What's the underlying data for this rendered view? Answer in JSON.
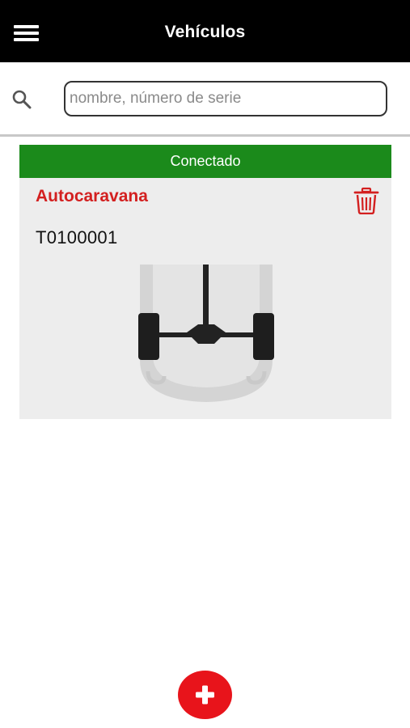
{
  "header": {
    "title": "Vehículos",
    "menu_icon": "hamburger-menu-icon"
  },
  "search": {
    "icon": "search-icon",
    "placeholder": "nombre, número de serie",
    "value": ""
  },
  "vehicles": [
    {
      "status": "Conectado",
      "status_color": "#1b8a1b",
      "name": "Autocaravana",
      "name_color": "#d32020",
      "serial": "T0100001",
      "delete_icon": "trash-icon",
      "image": "vehicle-axle-diagram"
    }
  ],
  "fab": {
    "icon": "plus-icon",
    "color": "#e8141b"
  }
}
